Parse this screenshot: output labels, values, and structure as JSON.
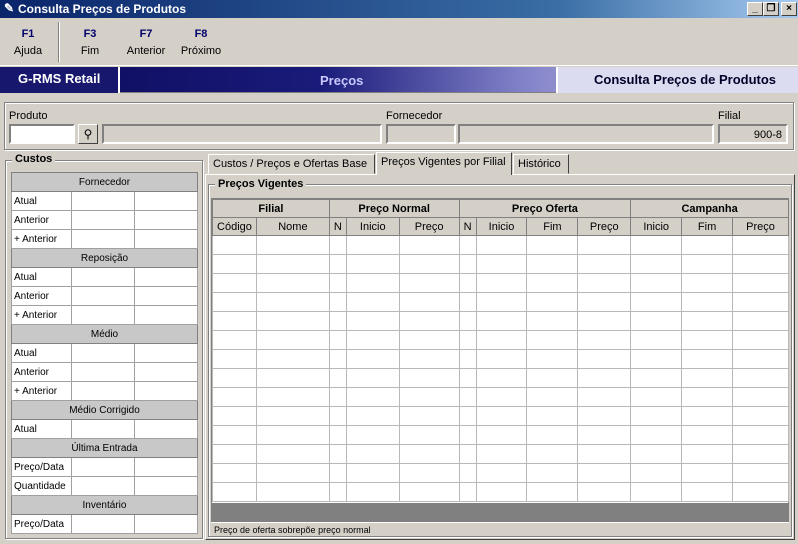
{
  "window": {
    "title": "Consulta Preços de Produtos"
  },
  "toolbar": {
    "keys": [
      {
        "key": "F1",
        "label": "Ajuda"
      },
      {
        "key": "F3",
        "label": "Fim"
      },
      {
        "key": "F7",
        "label": "Anterior"
      },
      {
        "key": "F8",
        "label": "Próximo"
      }
    ]
  },
  "banner": {
    "app": "G-RMS Retail",
    "module": "Preços",
    "screen": "Consulta Preços de Produtos"
  },
  "filter": {
    "produto_label": "Produto",
    "produto_value": "",
    "fornecedor_label": "Fornecedor",
    "filial_label": "Filial",
    "filial_value": "900-8"
  },
  "custos": {
    "title": "Custos",
    "sections": [
      {
        "title": "Fornecedor",
        "rows": [
          "Atual",
          "Anterior",
          "+ Anterior"
        ]
      },
      {
        "title": "Reposição",
        "rows": [
          "Atual",
          "Anterior",
          "+ Anterior"
        ]
      },
      {
        "title": "Médio",
        "rows": [
          "Atual",
          "Anterior",
          "+ Anterior"
        ]
      },
      {
        "title": "Médio Corrigido",
        "rows": [
          "Atual"
        ]
      },
      {
        "title": "Última Entrada",
        "rows": [
          "Preço/Data",
          "Quantidade"
        ]
      },
      {
        "title": "Inventário",
        "rows": [
          "Preço/Data"
        ]
      }
    ]
  },
  "tabs": [
    {
      "label": "Custos / Preços e Ofertas Base",
      "active": false
    },
    {
      "label": "Preços Vigentes por Filial",
      "active": true
    },
    {
      "label": "Histórico",
      "active": false
    }
  ],
  "precos": {
    "title": "Preços Vigentes",
    "groups": [
      "Filial",
      "Preço Normal",
      "Preço Oferta",
      "Campanha"
    ],
    "columns": [
      "Código",
      "Nome",
      "N",
      "Inicio",
      "Preço",
      "N",
      "Inicio",
      "Fim",
      "Preço",
      "Inicio",
      "Fim",
      "Preço"
    ],
    "status": "Preço de oferta sobrepõe preço normal"
  }
}
